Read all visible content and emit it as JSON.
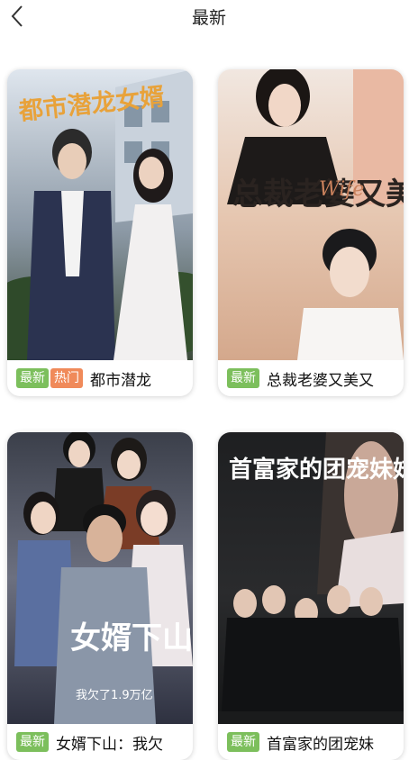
{
  "header": {
    "title": "最新",
    "back_icon": "chevron-left-icon"
  },
  "colors": {
    "badge_new": "#7cbf5c",
    "badge_hot": "#f08a5a"
  },
  "cards": [
    {
      "title": "都市潜龙",
      "badges": [
        "最新",
        "热门"
      ],
      "poster_text": "都市潜龙女婿"
    },
    {
      "title": "总裁老婆又美又",
      "badges": [
        "最新"
      ],
      "poster_text": "总裁老婆又美又飒",
      "poster_subtext": "Wife"
    },
    {
      "title": "女婿下山：我欠",
      "badges": [
        "最新"
      ],
      "poster_text": "女婿下山",
      "poster_subtext": "我欠了1.9万亿"
    },
    {
      "title": "首富家的团宠妹",
      "badges": [
        "最新"
      ],
      "poster_text": "首富家的团宠妹妹"
    }
  ]
}
